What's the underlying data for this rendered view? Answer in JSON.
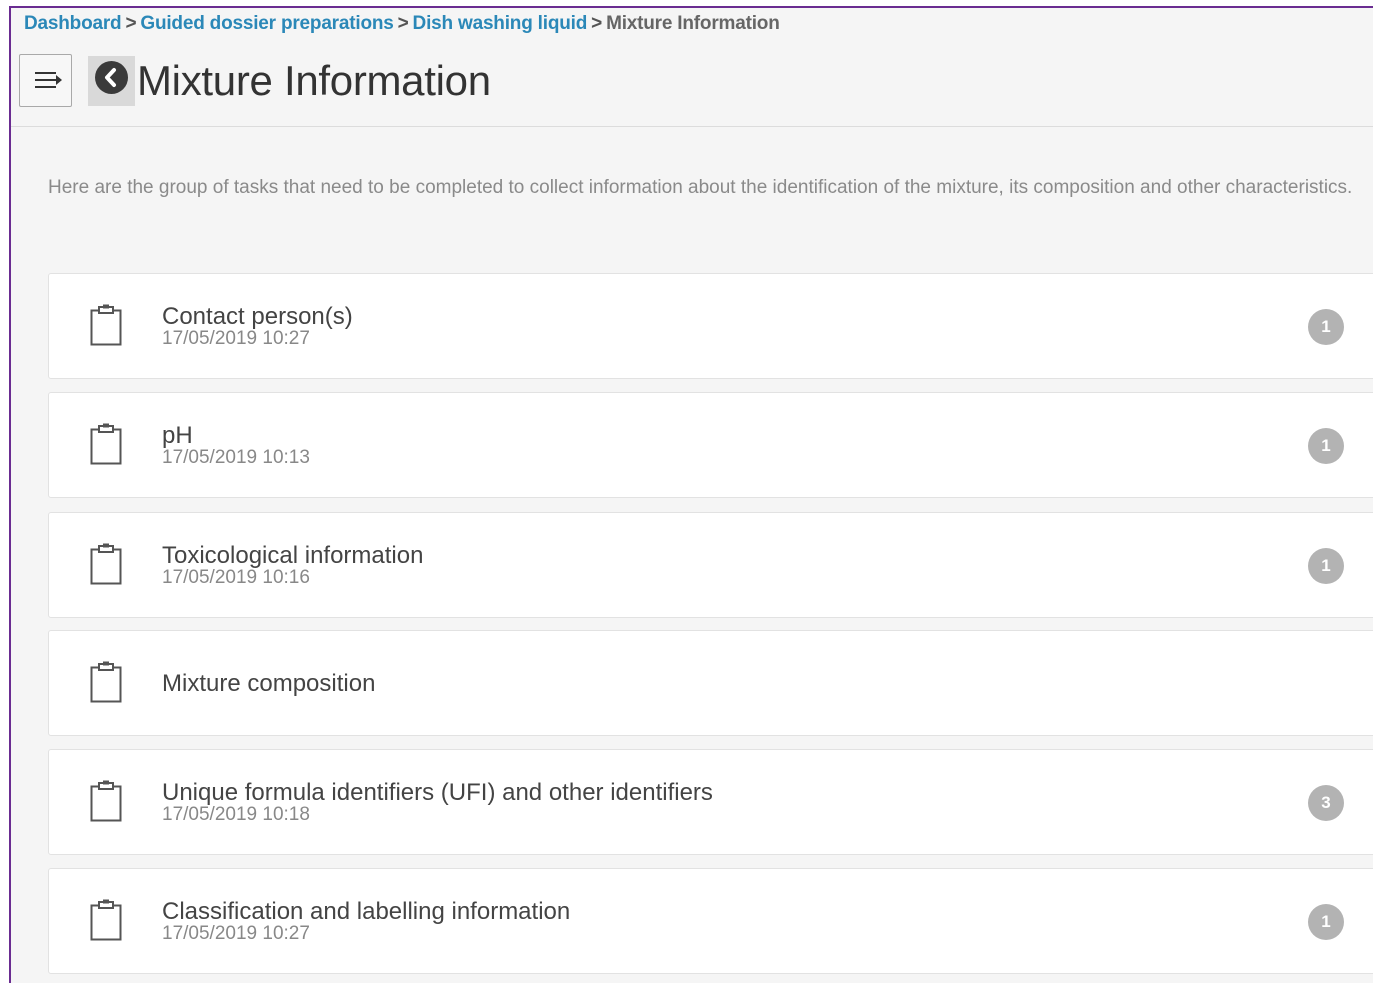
{
  "breadcrumb": {
    "items": [
      "Dashboard",
      "Guided dossier preparations",
      "Dish washing liquid"
    ],
    "current": "Mixture Information",
    "separator": ">"
  },
  "header": {
    "title": "Mixture Information",
    "menu_icon": "menu-icon",
    "back_icon": "chevron-left-circle-icon"
  },
  "intro": "Here are the group of tasks that need to be completed to collect information about the identification of the mixture, its composition and other characteristics.",
  "tasks": [
    {
      "title": "Contact person(s)",
      "date": "17/05/2019 10:27",
      "count": "1",
      "icon": "clipboard-icon"
    },
    {
      "title": "pH",
      "date": "17/05/2019 10:13",
      "count": "1",
      "icon": "clipboard-icon"
    },
    {
      "title": "Toxicological information",
      "date": "17/05/2019 10:16",
      "count": "1",
      "icon": "clipboard-icon"
    },
    {
      "title": "Mixture composition",
      "date": "",
      "count": "",
      "icon": "clipboard-icon"
    },
    {
      "title": "Unique formula identifiers (UFI) and other identifiers",
      "date": "17/05/2019 10:18",
      "count": "3",
      "icon": "clipboard-icon"
    },
    {
      "title": "Classification and labelling information",
      "date": "17/05/2019 10:27",
      "count": "1",
      "icon": "clipboard-icon"
    }
  ],
  "colors": {
    "link": "#2b88b8",
    "frame_border": "#6a2c91",
    "badge": "#b3b3b3",
    "background": "#f5f5f5"
  }
}
